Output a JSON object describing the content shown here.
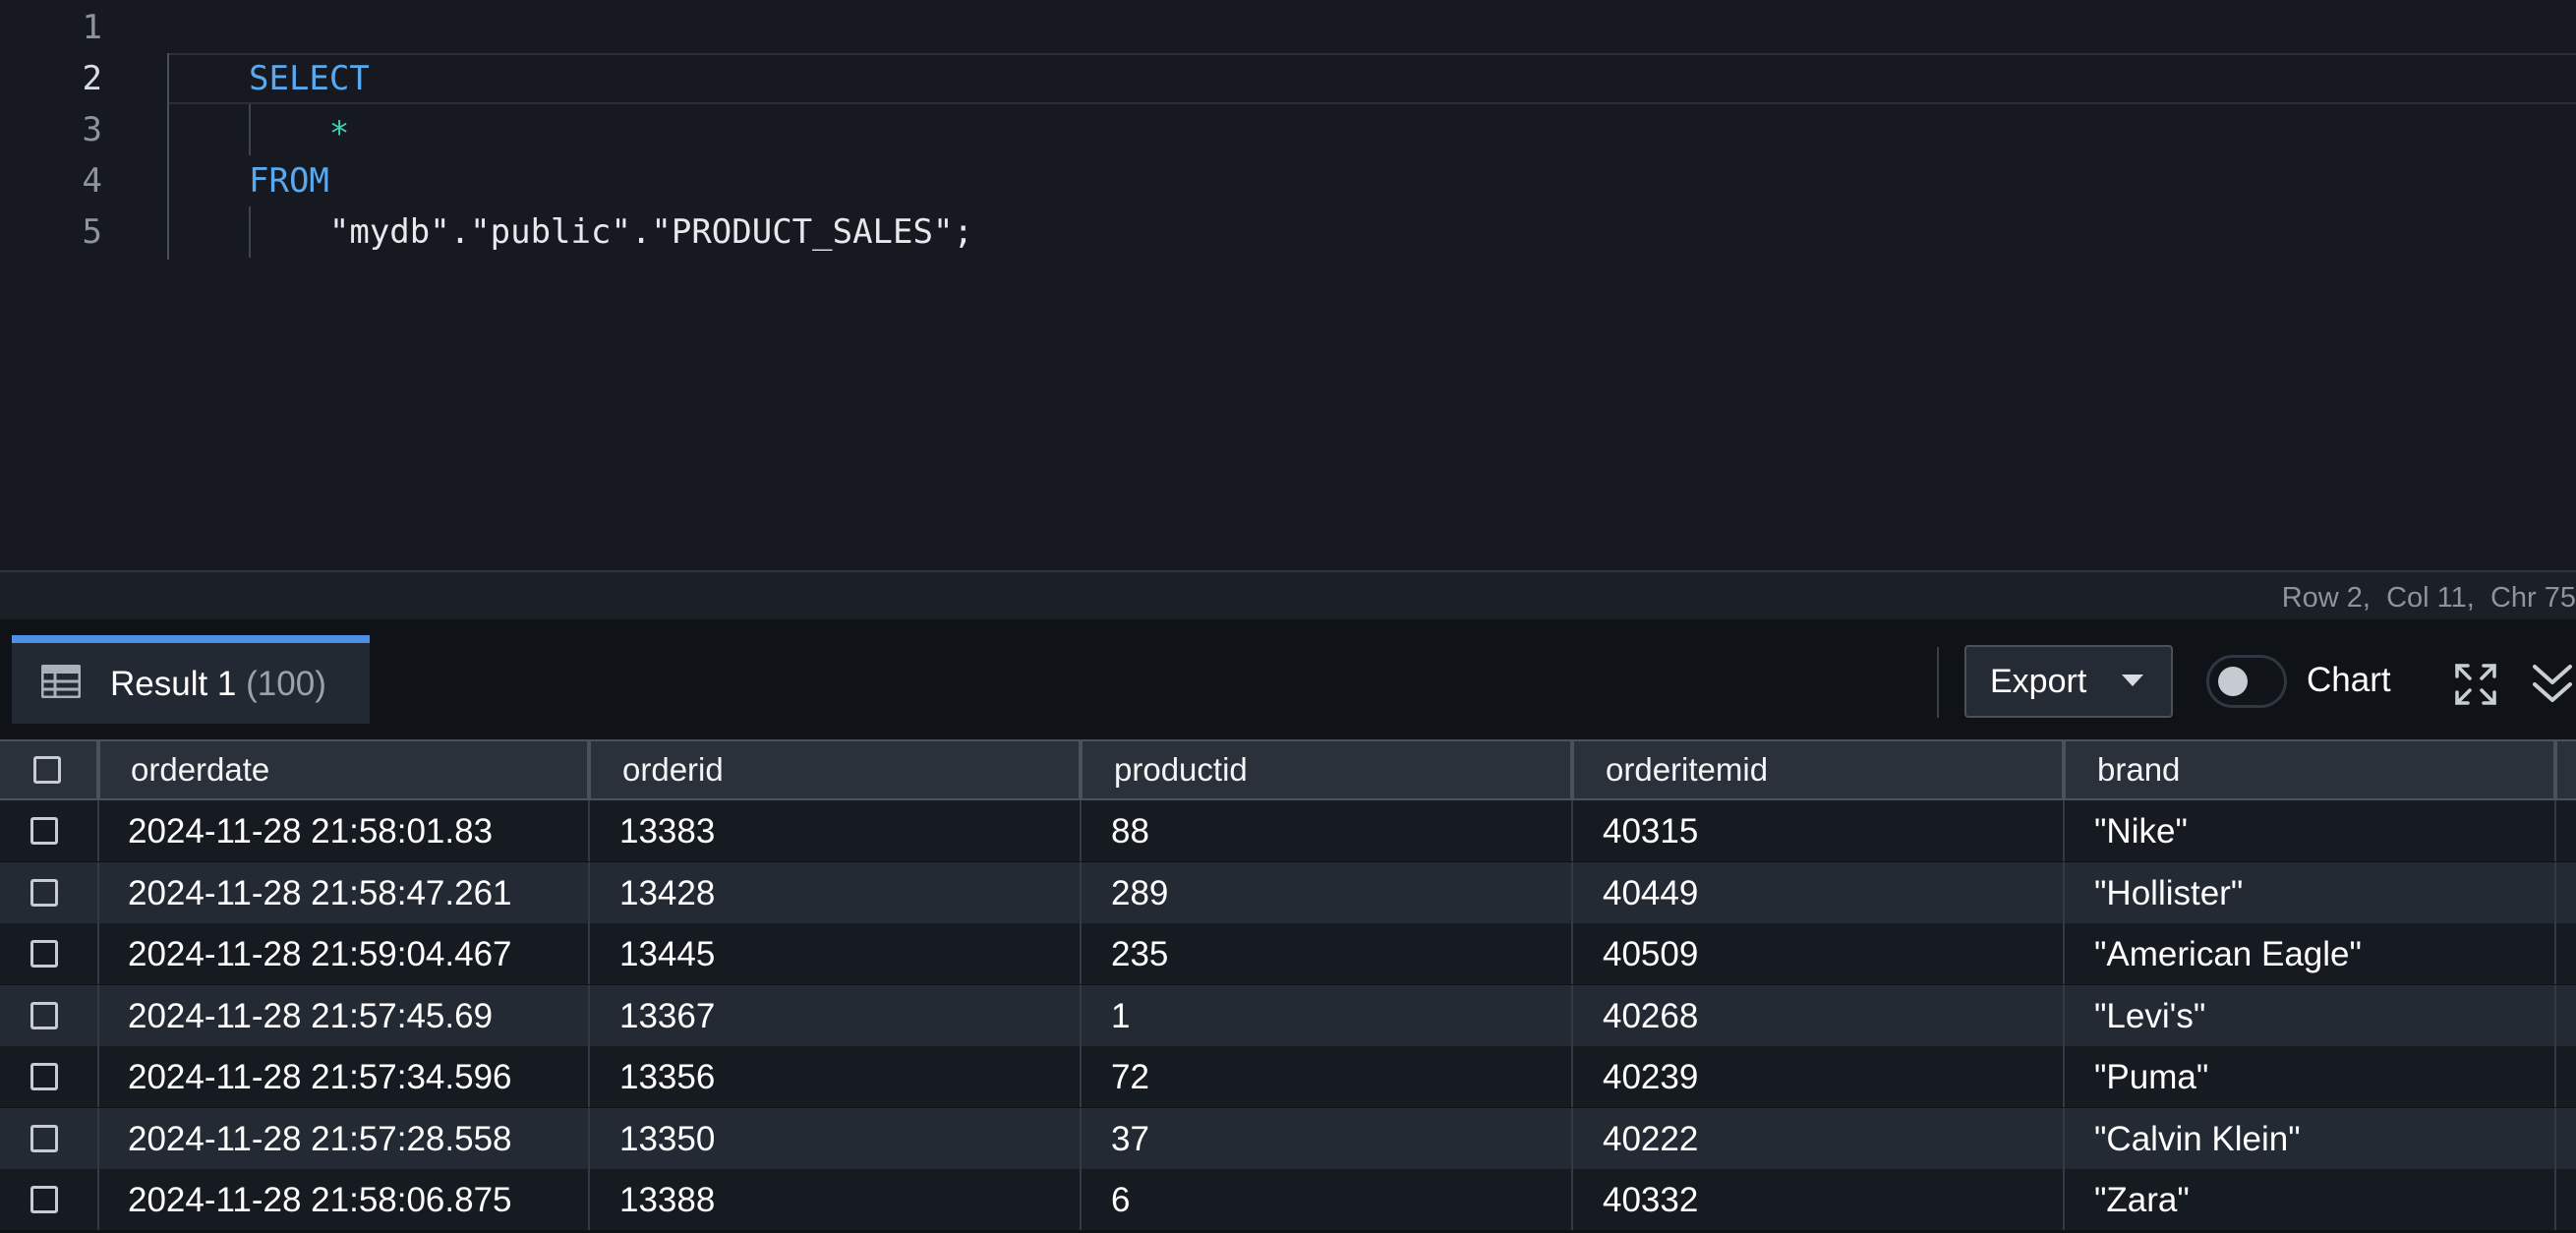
{
  "editor": {
    "line_numbers": [
      "1",
      "2",
      "3",
      "4",
      "5"
    ],
    "active_line": "2",
    "lines": [
      {
        "tokens": []
      },
      {
        "tokens": [
          {
            "text": "SELECT",
            "kind": "keyword"
          }
        ]
      },
      {
        "tokens": [
          {
            "text": "    *",
            "kind": "operator"
          }
        ]
      },
      {
        "tokens": [
          {
            "text": "FROM",
            "kind": "keyword"
          }
        ]
      },
      {
        "tokens": [
          {
            "text": "    \"mydb\".\"public\".\"PRODUCT_SALES\";",
            "kind": "string"
          }
        ]
      }
    ]
  },
  "status_bar": {
    "cursor_position": "Row 2,  Col 11,  Chr 75"
  },
  "results": {
    "tab": {
      "icon": "table-icon",
      "label": "Result 1",
      "count": "(100)"
    },
    "toolbar": {
      "export_label": "Export",
      "export_icon": "caret-down-icon",
      "chart_toggle_on": false,
      "chart_label": "Chart",
      "fullscreen_icon": "fullscreen-icon",
      "collapse_icon": "chevron-double-down-icon"
    },
    "columns": [
      "orderdate",
      "orderid",
      "productid",
      "orderitemid",
      "brand"
    ],
    "rows": [
      [
        "2024-11-28 21:58:01.83",
        "13383",
        "88",
        "40315",
        "\"Nike\""
      ],
      [
        "2024-11-28 21:58:47.261",
        "13428",
        "289",
        "40449",
        "\"Hollister\""
      ],
      [
        "2024-11-28 21:59:04.467",
        "13445",
        "235",
        "40509",
        "\"American Eagle\""
      ],
      [
        "2024-11-28 21:57:45.69",
        "13367",
        "1",
        "40268",
        "\"Levi's\""
      ],
      [
        "2024-11-28 21:57:34.596",
        "13356",
        "72",
        "40239",
        "\"Puma\""
      ],
      [
        "2024-11-28 21:57:28.558",
        "13350",
        "37",
        "40222",
        "\"Calvin Klein\""
      ],
      [
        "2024-11-28 21:58:06.875",
        "13388",
        "6",
        "40332",
        "\"Zara\""
      ]
    ]
  },
  "colors": {
    "keyword": "#5aa9ee",
    "operator": "#3fd0b4",
    "accent": "#4f8fe6"
  }
}
